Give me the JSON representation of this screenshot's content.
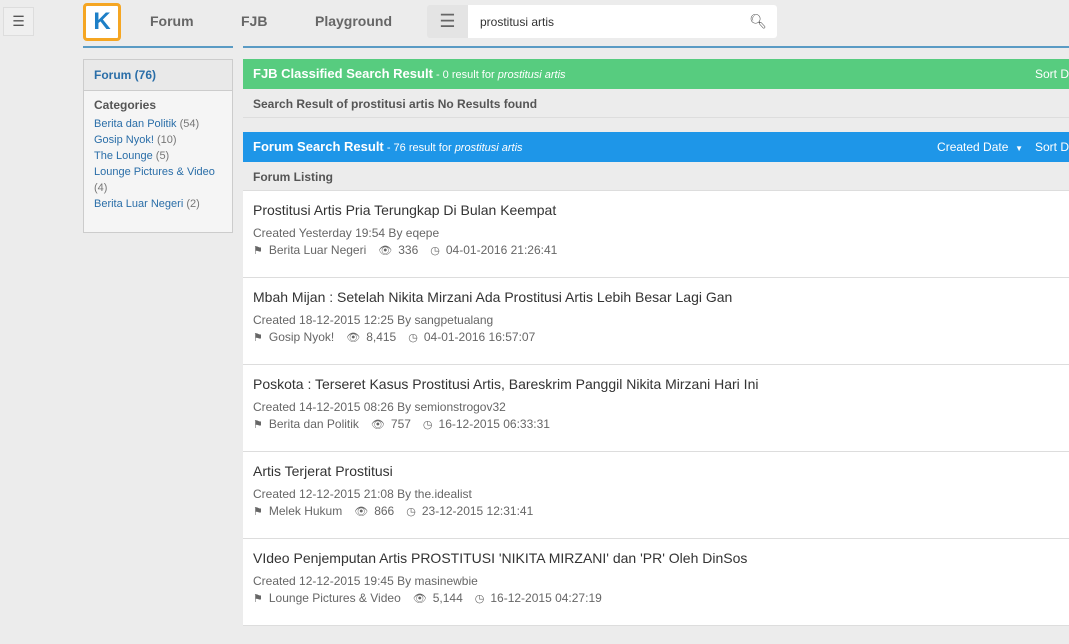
{
  "header": {
    "menu_icon": "hamburger-icon",
    "logo": "K",
    "nav": [
      "Forum",
      "FJB",
      "Playground"
    ],
    "search_value": "prostitusi artis"
  },
  "sidebar": {
    "title": "Forum (76)",
    "categories_label": "Categories",
    "categories": [
      {
        "name": "Berita dan Politik",
        "count": "(54)"
      },
      {
        "name": "Gosip Nyok!",
        "count": "(10)"
      },
      {
        "name": "The Lounge",
        "count": "(5)"
      },
      {
        "name": "Lounge Pictures & Video",
        "count": "(4)"
      },
      {
        "name": "Berita Luar Negeri",
        "count": "(2)"
      }
    ]
  },
  "fjb": {
    "title": "FJB Classified Search Result",
    "summary": " - 0 result for ",
    "query": "prostitusi artis",
    "sort": "Sort D",
    "message": "Search Result of prostitusi artis No Results found",
    "color": "#57cc7f"
  },
  "forum": {
    "title": "Forum Search Result",
    "summary": " - 76 result for ",
    "query": "prostitusi artis",
    "sort_field": "Created Date",
    "sort": "Sort D",
    "listing": "Forum Listing",
    "color": "#1e96e8",
    "items": [
      {
        "title": "Prostitusi Artis Pria Terungkap Di Bulan Keempat",
        "created": "Created Yesterday 19:54 By eqepe",
        "category": "Berita Luar Negeri",
        "views": "336",
        "last": "04-01-2016 21:26:41"
      },
      {
        "title": "Mbah Mijan : Setelah Nikita Mirzani Ada Prostitusi Artis Lebih Besar Lagi Gan",
        "created": "Created 18-12-2015 12:25 By sangpetualang",
        "category": "Gosip Nyok!",
        "views": "8,415",
        "last": "04-01-2016 16:57:07"
      },
      {
        "title": "Poskota : Terseret Kasus Prostitusi Artis, Bareskrim Panggil Nikita Mirzani Hari Ini",
        "created": "Created 14-12-2015 08:26 By semionstrogov32",
        "category": "Berita dan Politik",
        "views": "757",
        "last": "16-12-2015 06:33:31"
      },
      {
        "title": "Artis Terjerat Prostitusi",
        "created": "Created 12-12-2015 21:08 By the.idealist",
        "category": "Melek Hukum",
        "views": "866",
        "last": "23-12-2015 12:31:41"
      },
      {
        "title": "VIdeo Penjemputan Artis PROSTITUSI 'NIKITA MIRZANI' dan 'PR' Oleh DinSos",
        "created": "Created 12-12-2015 19:45 By masinewbie",
        "category": "Lounge Pictures & Video",
        "views": "5,144",
        "last": "16-12-2015 04:27:19"
      }
    ]
  }
}
